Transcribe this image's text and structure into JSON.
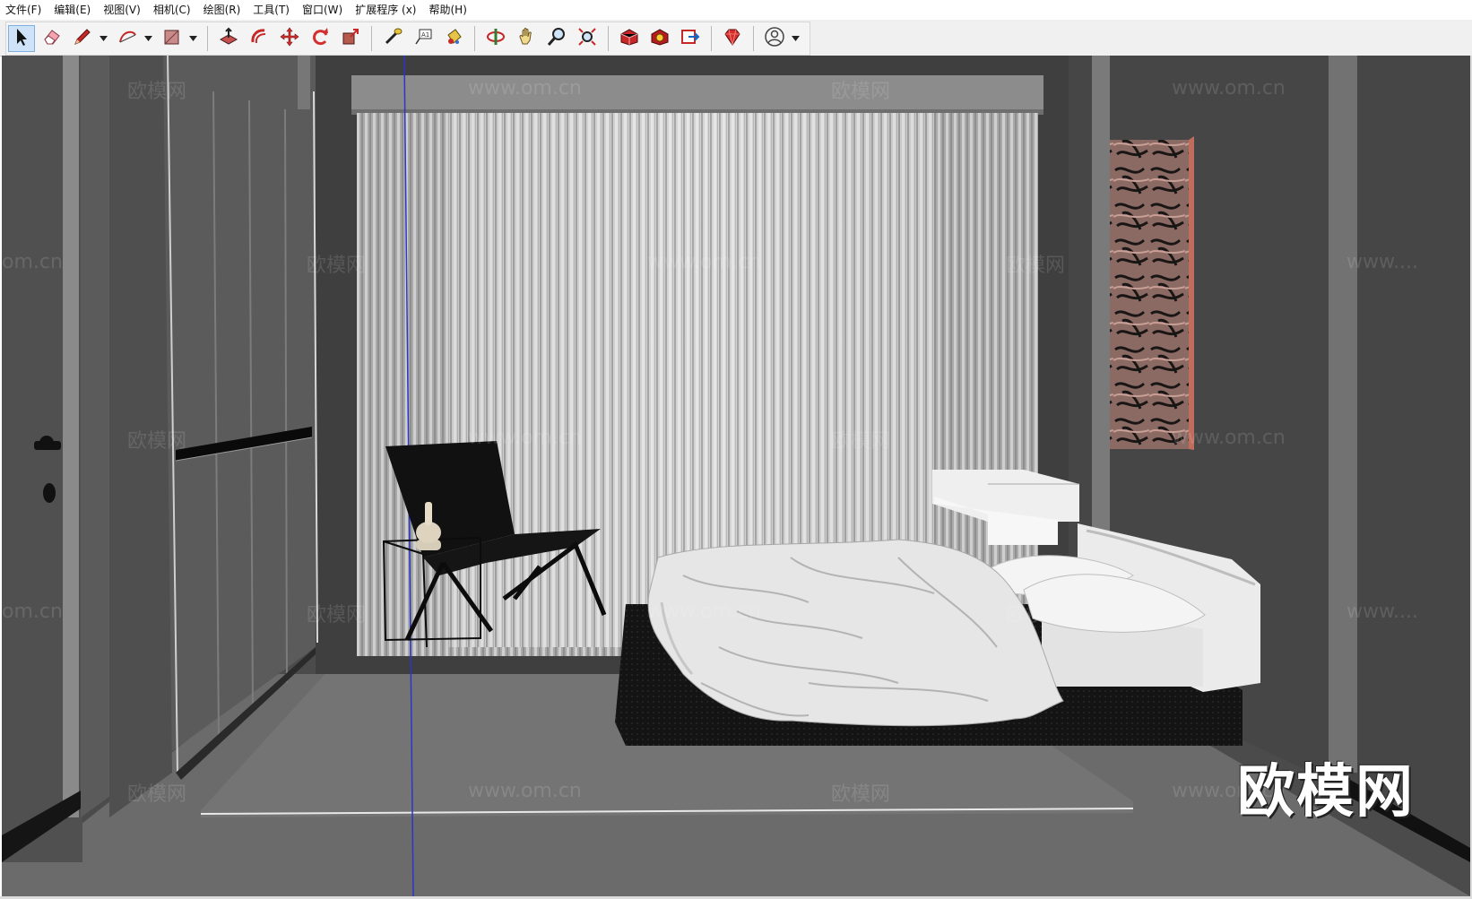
{
  "menu": {
    "items": [
      {
        "id": "file",
        "label": "文件(F)"
      },
      {
        "id": "edit",
        "label": "编辑(E)"
      },
      {
        "id": "view",
        "label": "视图(V)"
      },
      {
        "id": "camera",
        "label": "相机(C)"
      },
      {
        "id": "draw",
        "label": "绘图(R)"
      },
      {
        "id": "tools",
        "label": "工具(T)"
      },
      {
        "id": "window",
        "label": "窗口(W)"
      },
      {
        "id": "extensions",
        "label": "扩展程序 (x)"
      },
      {
        "id": "help",
        "label": "帮助(H)"
      }
    ]
  },
  "toolbar": {
    "tools": [
      {
        "id": "select",
        "icon": "select-arrow-icon",
        "active": true
      },
      {
        "id": "eraser",
        "icon": "eraser-icon"
      },
      {
        "id": "line",
        "icon": "pencil-line-icon",
        "dropdown": true
      },
      {
        "id": "arc",
        "icon": "arc-icon",
        "dropdown": true
      },
      {
        "id": "shape",
        "icon": "rectangle-icon",
        "dropdown": true
      },
      {
        "id": "push-pull",
        "icon": "push-pull-icon"
      },
      {
        "id": "offset",
        "icon": "offset-icon"
      },
      {
        "id": "move",
        "icon": "move-icon"
      },
      {
        "id": "rotate",
        "icon": "rotate-icon"
      },
      {
        "id": "scale",
        "icon": "scale-icon"
      },
      {
        "id": "tape-measure",
        "icon": "tape-measure-icon"
      },
      {
        "id": "text",
        "icon": "text-icon"
      },
      {
        "id": "paint-bucket",
        "icon": "paint-bucket-icon"
      },
      {
        "id": "orbit",
        "icon": "orbit-icon"
      },
      {
        "id": "pan",
        "icon": "pan-hand-icon"
      },
      {
        "id": "zoom",
        "icon": "zoom-icon"
      },
      {
        "id": "zoom-extents",
        "icon": "zoom-extents-icon"
      },
      {
        "id": "3d-warehouse",
        "icon": "warehouse-icon"
      },
      {
        "id": "extension-warehouse",
        "icon": "extension-warehouse-icon"
      },
      {
        "id": "send-to-layout",
        "icon": "layout-icon"
      },
      {
        "id": "ruby",
        "icon": "ruby-gem-icon"
      },
      {
        "id": "account",
        "icon": "user-account-icon",
        "dropdown": true
      }
    ],
    "separators_after": [
      "shape",
      "scale",
      "paint-bucket",
      "zoom-extents",
      "send-to-layout",
      "ruby"
    ]
  },
  "viewport": {
    "watermarks": [
      "欧模网",
      "www.om.cn",
      "欧模网",
      "www.om.cn",
      "om.cn",
      "欧模网",
      "www.om.cn",
      "欧模网",
      "www....",
      "欧模网",
      "www.om.cn",
      "欧模网",
      "www.om.cn",
      "om.cn",
      "欧模网",
      "www.om.cn",
      "欧模网",
      "www....",
      "欧模网",
      "www.om.cn",
      "欧模网",
      "www.om.cn"
    ],
    "brand_watermark": "欧模网"
  }
}
